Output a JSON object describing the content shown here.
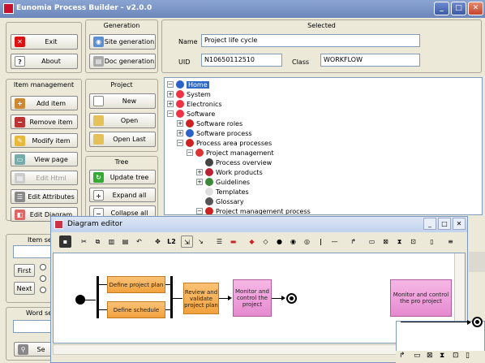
{
  "app": {
    "title": "Eunomia Process Builder - v2.0.0"
  },
  "left": {
    "exit_label": "Exit",
    "about_label": "About"
  },
  "generation": {
    "header": "Generation",
    "site_label": "Site generation",
    "doc_label": "Doc generation"
  },
  "selected": {
    "header": "Selected",
    "name_label": "Name",
    "name_value": "Project life cycle",
    "uid_label": "UID",
    "uid_value": "N10650112510",
    "class_label": "Class",
    "class_value": "WORKFLOW"
  },
  "item_management": {
    "header": "Item management",
    "add": "Add item",
    "remove": "Remove item",
    "modify": "Modify item",
    "view": "View page",
    "edit_html": "Edit Html",
    "edit_attrs": "Edit Attributes",
    "edit_diagram": "Edit Diagram"
  },
  "project": {
    "header": "Project",
    "new": "New",
    "open": "Open",
    "open_last": "Open Last"
  },
  "tree_group": {
    "header": "Tree",
    "update": "Update tree",
    "expand": "Expand all",
    "collapse": "Collapse all"
  },
  "item_search": {
    "header": "Item se",
    "first": "First",
    "next": "Next"
  },
  "word_search": {
    "header": "Word se",
    "search_btn": "Se"
  },
  "tree": [
    {
      "label": "Home"
    },
    {
      "label": "System"
    },
    {
      "label": "Electronics"
    },
    {
      "label": "Software"
    },
    {
      "label": "Software roles"
    },
    {
      "label": "Software process"
    },
    {
      "label": "Process area processes"
    },
    {
      "label": "Project management"
    },
    {
      "label": "Process overview"
    },
    {
      "label": "Work products"
    },
    {
      "label": "Guidelines"
    },
    {
      "label": "Templates"
    },
    {
      "label": "Glossary"
    },
    {
      "label": "Project management process"
    }
  ],
  "diagram": {
    "title": "Diagram editor",
    "toolbar_l2": "L2",
    "nodes": {
      "define_plan": "Define project plan",
      "define_schedule": "Define schedule",
      "review": "Review and validate project plan",
      "monitor": "Monitor and control the project",
      "monitor2": "Monitor and control the pro project"
    }
  },
  "colors": {
    "titlebar": "#7a94c8",
    "orange_node": "#f4a949",
    "pink_node": "#eb9ad8",
    "selection": "#316ac5"
  }
}
